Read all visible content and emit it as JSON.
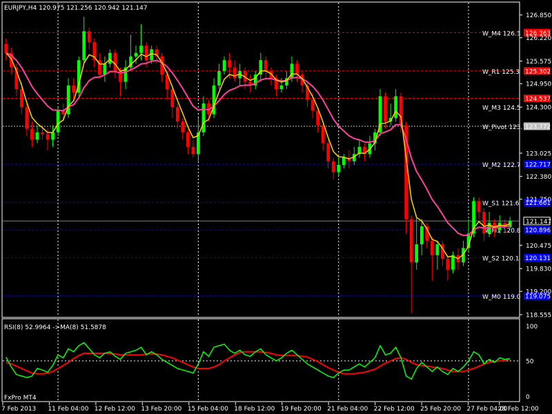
{
  "header": {
    "symbol_tf": "EURJPY,H4",
    "ohlc": "120.975 121.256 120.942 121.147"
  },
  "rsi_header": {
    "text": "RSI(8) 52.9964 ->MA(8) 51.5878"
  },
  "broker_label": "FxPro MT4",
  "colors": {
    "background": "#000000",
    "bull": "#00ff00",
    "bear": "#ff0000",
    "ma_fast": "#ffd200",
    "ma_slow": "#ff40a0",
    "rsi": "#00ff00",
    "rsi_ma": "#ff0000",
    "pivot_blue": "#0000ff",
    "pivot_red": "#ff0000",
    "axis": "#ffffff",
    "grid": "#ffffff"
  },
  "chart_data": [
    {
      "type": "candlestick",
      "series": [
        {
          "name": "EURJPY,H4"
        }
      ],
      "ylim": [
        118.555,
        127.15
      ],
      "y_ticks": [
        "126.850",
        "126.220",
        "125.575",
        "124.950",
        "124.300",
        "123.025",
        "122.380",
        "121.750",
        "120.475",
        "119.830",
        "119.200",
        "118.555"
      ],
      "x_ticks": [
        "7 Feb 2013",
        "11 Feb 04:00",
        "12 Feb 12:00",
        "13 Feb 20:00",
        "15 Feb 04:00",
        "18 Feb 12:00",
        "19 Feb 20:00",
        "21 Feb 04:00",
        "22 Feb 12:00",
        "25 Feb 20:00",
        "27 Feb 04:00",
        "28 Feb 12:00"
      ],
      "last_price": "121.147",
      "levels": [
        {
          "label": "W_M4 126.3",
          "tag": "126.363",
          "value": 126.36,
          "color": "red"
        },
        {
          "label": "W_R1 125.3",
          "tag": "125.302",
          "value": 125.3,
          "color": "red"
        },
        {
          "label": "",
          "tag": "124.537",
          "value": 124.54,
          "color": "red"
        },
        {
          "label": "W_M3 124.5",
          "tag": "",
          "value": 124.3,
          "color": "none"
        },
        {
          "label": "W_Pivot 123.7",
          "tag": "123.772",
          "value": 123.77,
          "color": "white"
        },
        {
          "label": "W_M2 122.7",
          "tag": "122.717",
          "value": 122.72,
          "color": "blue"
        },
        {
          "label": "W_S1 121.6",
          "tag": "121.661",
          "value": 121.66,
          "color": "blue"
        },
        {
          "label": "W_M1 120.8",
          "tag": "120.896",
          "value": 120.9,
          "color": "blue"
        },
        {
          "label": "W_S2 120.1",
          "tag": "120.131",
          "value": 120.13,
          "color": "blue"
        },
        {
          "label": "W_M0 119.0",
          "tag": "119.075",
          "value": 119.07,
          "color": "blue"
        }
      ],
      "candles": [
        [
          126.05,
          125.8,
          126.2,
          125.6
        ],
        [
          125.8,
          125.4,
          125.95,
          125.2
        ],
        [
          125.4,
          124.8,
          125.5,
          124.6
        ],
        [
          124.8,
          124.3,
          125.0,
          124.1
        ],
        [
          124.3,
          123.7,
          124.4,
          123.5
        ],
        [
          123.7,
          123.4,
          123.9,
          123.2
        ],
        [
          123.4,
          123.6,
          123.8,
          123.3
        ],
        [
          123.6,
          123.55,
          123.8,
          123.4
        ],
        [
          123.55,
          123.4,
          123.7,
          123.1
        ],
        [
          123.4,
          123.6,
          123.8,
          123.2
        ],
        [
          123.6,
          124.2,
          124.3,
          123.5
        ],
        [
          124.2,
          124.1,
          124.4,
          123.9
        ],
        [
          124.1,
          124.9,
          125.1,
          124.0
        ],
        [
          124.9,
          124.7,
          125.1,
          124.5
        ],
        [
          124.7,
          125.6,
          125.7,
          124.6
        ],
        [
          125.6,
          126.4,
          126.8,
          125.5
        ],
        [
          126.4,
          126.1,
          126.5,
          125.9
        ],
        [
          126.1,
          125.6,
          126.2,
          125.4
        ],
        [
          125.6,
          125.2,
          125.8,
          125.1
        ],
        [
          125.2,
          125.5,
          125.7,
          125.0
        ],
        [
          125.5,
          125.8,
          125.9,
          125.4
        ],
        [
          125.8,
          125.3,
          125.9,
          125.1
        ],
        [
          125.3,
          125.0,
          125.4,
          124.6
        ],
        [
          125.0,
          125.4,
          125.6,
          124.8
        ],
        [
          125.4,
          125.7,
          126.3,
          125.3
        ],
        [
          125.7,
          125.8,
          126.0,
          125.5
        ],
        [
          125.8,
          126.0,
          126.6,
          125.6
        ],
        [
          126.0,
          125.6,
          126.1,
          125.4
        ],
        [
          125.6,
          125.9,
          126.0,
          125.5
        ],
        [
          125.9,
          125.7,
          126.0,
          125.5
        ],
        [
          125.7,
          125.2,
          125.8,
          125.0
        ],
        [
          125.2,
          124.8,
          125.3,
          124.5
        ],
        [
          124.8,
          124.3,
          124.9,
          124.0
        ],
        [
          124.3,
          123.9,
          124.4,
          123.7
        ],
        [
          123.9,
          123.6,
          124.0,
          123.4
        ],
        [
          123.6,
          123.2,
          123.7,
          123.0
        ],
        [
          123.2,
          123.0,
          123.4,
          122.9
        ],
        [
          123.0,
          123.6,
          124.0,
          122.8
        ],
        [
          123.6,
          124.4,
          124.6,
          123.5
        ],
        [
          124.4,
          124.1,
          124.5,
          123.9
        ],
        [
          124.1,
          124.9,
          125.1,
          124.0
        ],
        [
          124.9,
          125.3,
          125.5,
          124.8
        ],
        [
          125.3,
          125.6,
          125.7,
          125.2
        ],
        [
          125.6,
          125.4,
          125.8,
          125.1
        ],
        [
          125.4,
          125.1,
          125.6,
          125.0
        ],
        [
          125.1,
          125.3,
          125.5,
          124.9
        ],
        [
          125.3,
          125.0,
          125.4,
          124.8
        ],
        [
          125.0,
          124.9,
          125.2,
          124.7
        ],
        [
          124.9,
          125.2,
          125.3,
          124.8
        ],
        [
          125.2,
          125.6,
          125.8,
          125.0
        ],
        [
          125.6,
          125.3,
          125.7,
          125.1
        ],
        [
          125.3,
          125.1,
          125.4,
          124.9
        ],
        [
          125.1,
          124.8,
          125.2,
          124.6
        ],
        [
          124.8,
          124.9,
          125.1,
          124.7
        ],
        [
          124.9,
          125.1,
          125.3,
          124.8
        ],
        [
          125.1,
          125.5,
          125.7,
          125.0
        ],
        [
          125.5,
          125.2,
          125.6,
          125.0
        ],
        [
          125.2,
          124.9,
          125.3,
          124.7
        ],
        [
          124.9,
          124.5,
          125.0,
          124.3
        ],
        [
          124.5,
          124.2,
          124.7,
          124.0
        ],
        [
          124.2,
          123.8,
          124.3,
          123.6
        ],
        [
          123.8,
          123.3,
          123.9,
          123.1
        ],
        [
          123.3,
          122.8,
          123.4,
          122.6
        ],
        [
          122.8,
          122.5,
          122.9,
          122.3
        ],
        [
          122.5,
          122.7,
          122.9,
          122.4
        ],
        [
          122.7,
          122.9,
          123.0,
          122.6
        ],
        [
          122.9,
          122.8,
          123.1,
          122.6
        ],
        [
          122.8,
          123.0,
          123.2,
          122.7
        ],
        [
          123.0,
          123.2,
          123.4,
          122.9
        ],
        [
          123.2,
          123.0,
          123.3,
          122.8
        ],
        [
          123.0,
          123.3,
          123.5,
          122.9
        ],
        [
          123.3,
          123.6,
          123.7,
          123.1
        ],
        [
          123.6,
          124.6,
          124.8,
          123.5
        ],
        [
          124.6,
          123.9,
          124.7,
          123.7
        ],
        [
          123.9,
          124.0,
          124.4,
          123.8
        ],
        [
          124.0,
          124.6,
          124.8,
          123.9
        ],
        [
          124.6,
          123.8,
          124.7,
          123.6
        ],
        [
          123.8,
          121.2,
          123.9,
          120.8
        ],
        [
          121.2,
          120.0,
          121.3,
          118.6
        ],
        [
          120.0,
          120.5,
          121.3,
          119.8
        ],
        [
          120.5,
          121.0,
          121.2,
          120.2
        ],
        [
          121.0,
          120.6,
          121.1,
          120.4
        ],
        [
          120.6,
          120.2,
          120.7,
          119.5
        ],
        [
          120.2,
          120.5,
          120.6,
          119.8
        ],
        [
          120.5,
          120.1,
          120.6,
          119.9
        ],
        [
          120.1,
          119.8,
          120.2,
          119.5
        ],
        [
          119.8,
          120.2,
          120.3,
          119.7
        ],
        [
          120.2,
          120.0,
          120.4,
          119.8
        ],
        [
          120.0,
          120.4,
          120.6,
          119.9
        ],
        [
          120.4,
          120.8,
          121.2,
          120.3
        ],
        [
          120.8,
          121.7,
          121.8,
          120.7
        ],
        [
          121.7,
          121.4,
          121.8,
          121.2
        ],
        [
          121.4,
          120.8,
          121.5,
          120.6
        ],
        [
          120.8,
          121.1,
          121.4,
          120.7
        ],
        [
          121.1,
          120.9,
          121.2,
          120.7
        ],
        [
          120.9,
          121.1,
          121.3,
          120.8
        ],
        [
          121.1,
          121.0,
          121.2,
          120.8
        ],
        [
          120.98,
          121.15,
          121.26,
          120.94
        ]
      ],
      "rsi": {
        "name": "RSI(8)",
        "value": 52.9964,
        "ma_name": "MA(8)",
        "ma_value": 51.5878,
        "ylim": [
          0,
          100
        ],
        "y_ticks": [
          "100",
          "50",
          "0"
        ],
        "values": [
          55,
          42,
          32,
          30,
          28,
          30,
          40,
          38,
          35,
          44,
          58,
          54,
          66,
          62,
          70,
          74,
          66,
          58,
          54,
          60,
          62,
          56,
          52,
          60,
          62,
          64,
          68,
          58,
          62,
          58,
          52,
          48,
          44,
          40,
          38,
          36,
          34,
          46,
          62,
          56,
          68,
          70,
          72,
          64,
          60,
          64,
          58,
          56,
          62,
          66,
          58,
          54,
          50,
          54,
          60,
          64,
          58,
          52,
          46,
          42,
          38,
          34,
          30,
          28,
          34,
          38,
          38,
          42,
          46,
          42,
          48,
          54,
          70,
          58,
          60,
          68,
          54,
          30,
          26,
          40,
          48,
          42,
          36,
          42,
          36,
          32,
          40,
          36,
          42,
          50,
          62,
          58,
          46,
          52,
          48,
          54,
          52,
          53
        ],
        "ma_values": [
          48,
          46,
          43,
          40,
          37,
          34,
          33,
          33,
          34,
          36,
          40,
          44,
          48,
          53,
          57,
          60,
          60,
          60,
          60,
          60,
          60,
          59,
          58,
          58,
          58,
          58,
          58,
          59,
          59,
          59,
          58,
          56,
          54,
          51,
          48,
          45,
          42,
          40,
          40,
          40,
          42,
          45,
          50,
          54,
          58,
          61,
          62,
          62,
          62,
          62,
          61,
          60,
          58,
          57,
          57,
          57,
          57,
          56,
          55,
          52,
          49,
          45,
          41,
          38,
          35,
          33,
          33,
          33,
          34,
          35,
          37,
          39,
          43,
          47,
          50,
          53,
          54,
          52,
          48,
          45,
          44,
          43,
          42,
          41,
          40,
          38,
          36,
          36,
          36,
          38,
          40,
          43,
          46,
          48,
          49,
          50,
          51,
          51.6
        ]
      }
    }
  ]
}
